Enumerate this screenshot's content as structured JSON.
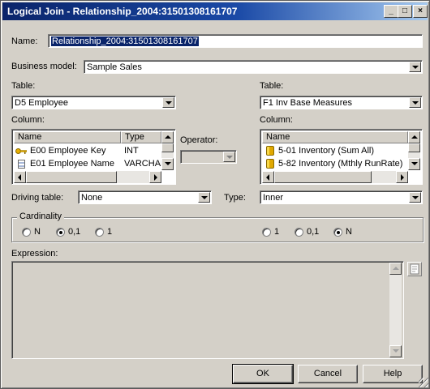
{
  "window": {
    "title": "Logical Join - Relationship_2004:31501308161707"
  },
  "name_field": {
    "label": "Name:",
    "value": "Relationship_2004:31501308161707"
  },
  "business_model": {
    "label": "Business model:",
    "value": "Sample Sales"
  },
  "left": {
    "table_label": "Table:",
    "table_value": "D5 Employee",
    "column_label": "Column:",
    "headers": [
      "Name",
      "Type"
    ],
    "rows": [
      {
        "name": "E00  Employee Key",
        "type": "INT",
        "icon": "key-icon"
      },
      {
        "name": "E01  Employee Name",
        "type": "VARCHAR",
        "icon": "column-icon"
      }
    ]
  },
  "operator": {
    "label": "Operator:",
    "value": ""
  },
  "right": {
    "table_label": "Table:",
    "table_value": "F1 Inv Base Measures",
    "column_label": "Column:",
    "headers": [
      "Name"
    ],
    "rows": [
      {
        "name": "5-01  Inventory  (Sum All)",
        "icon": "measure-icon"
      },
      {
        "name": "5-82  Inventory  (Mthly RunRate)",
        "icon": "measure-icon"
      }
    ]
  },
  "driving_table": {
    "label": "Driving table:",
    "value": "None"
  },
  "type": {
    "label": "Type:",
    "value": "Inner"
  },
  "cardinality": {
    "label": "Cardinality",
    "left_options": [
      "N",
      "0,1",
      "1"
    ],
    "left_selected": "0,1",
    "right_options": [
      "1",
      "0,1",
      "N"
    ],
    "right_selected": "N"
  },
  "expression": {
    "label": "Expression:",
    "value": ""
  },
  "buttons": {
    "ok": "OK",
    "cancel": "Cancel",
    "help": "Help"
  },
  "title_buttons": {
    "minimize": "_",
    "maximize": "□",
    "close": "×"
  }
}
